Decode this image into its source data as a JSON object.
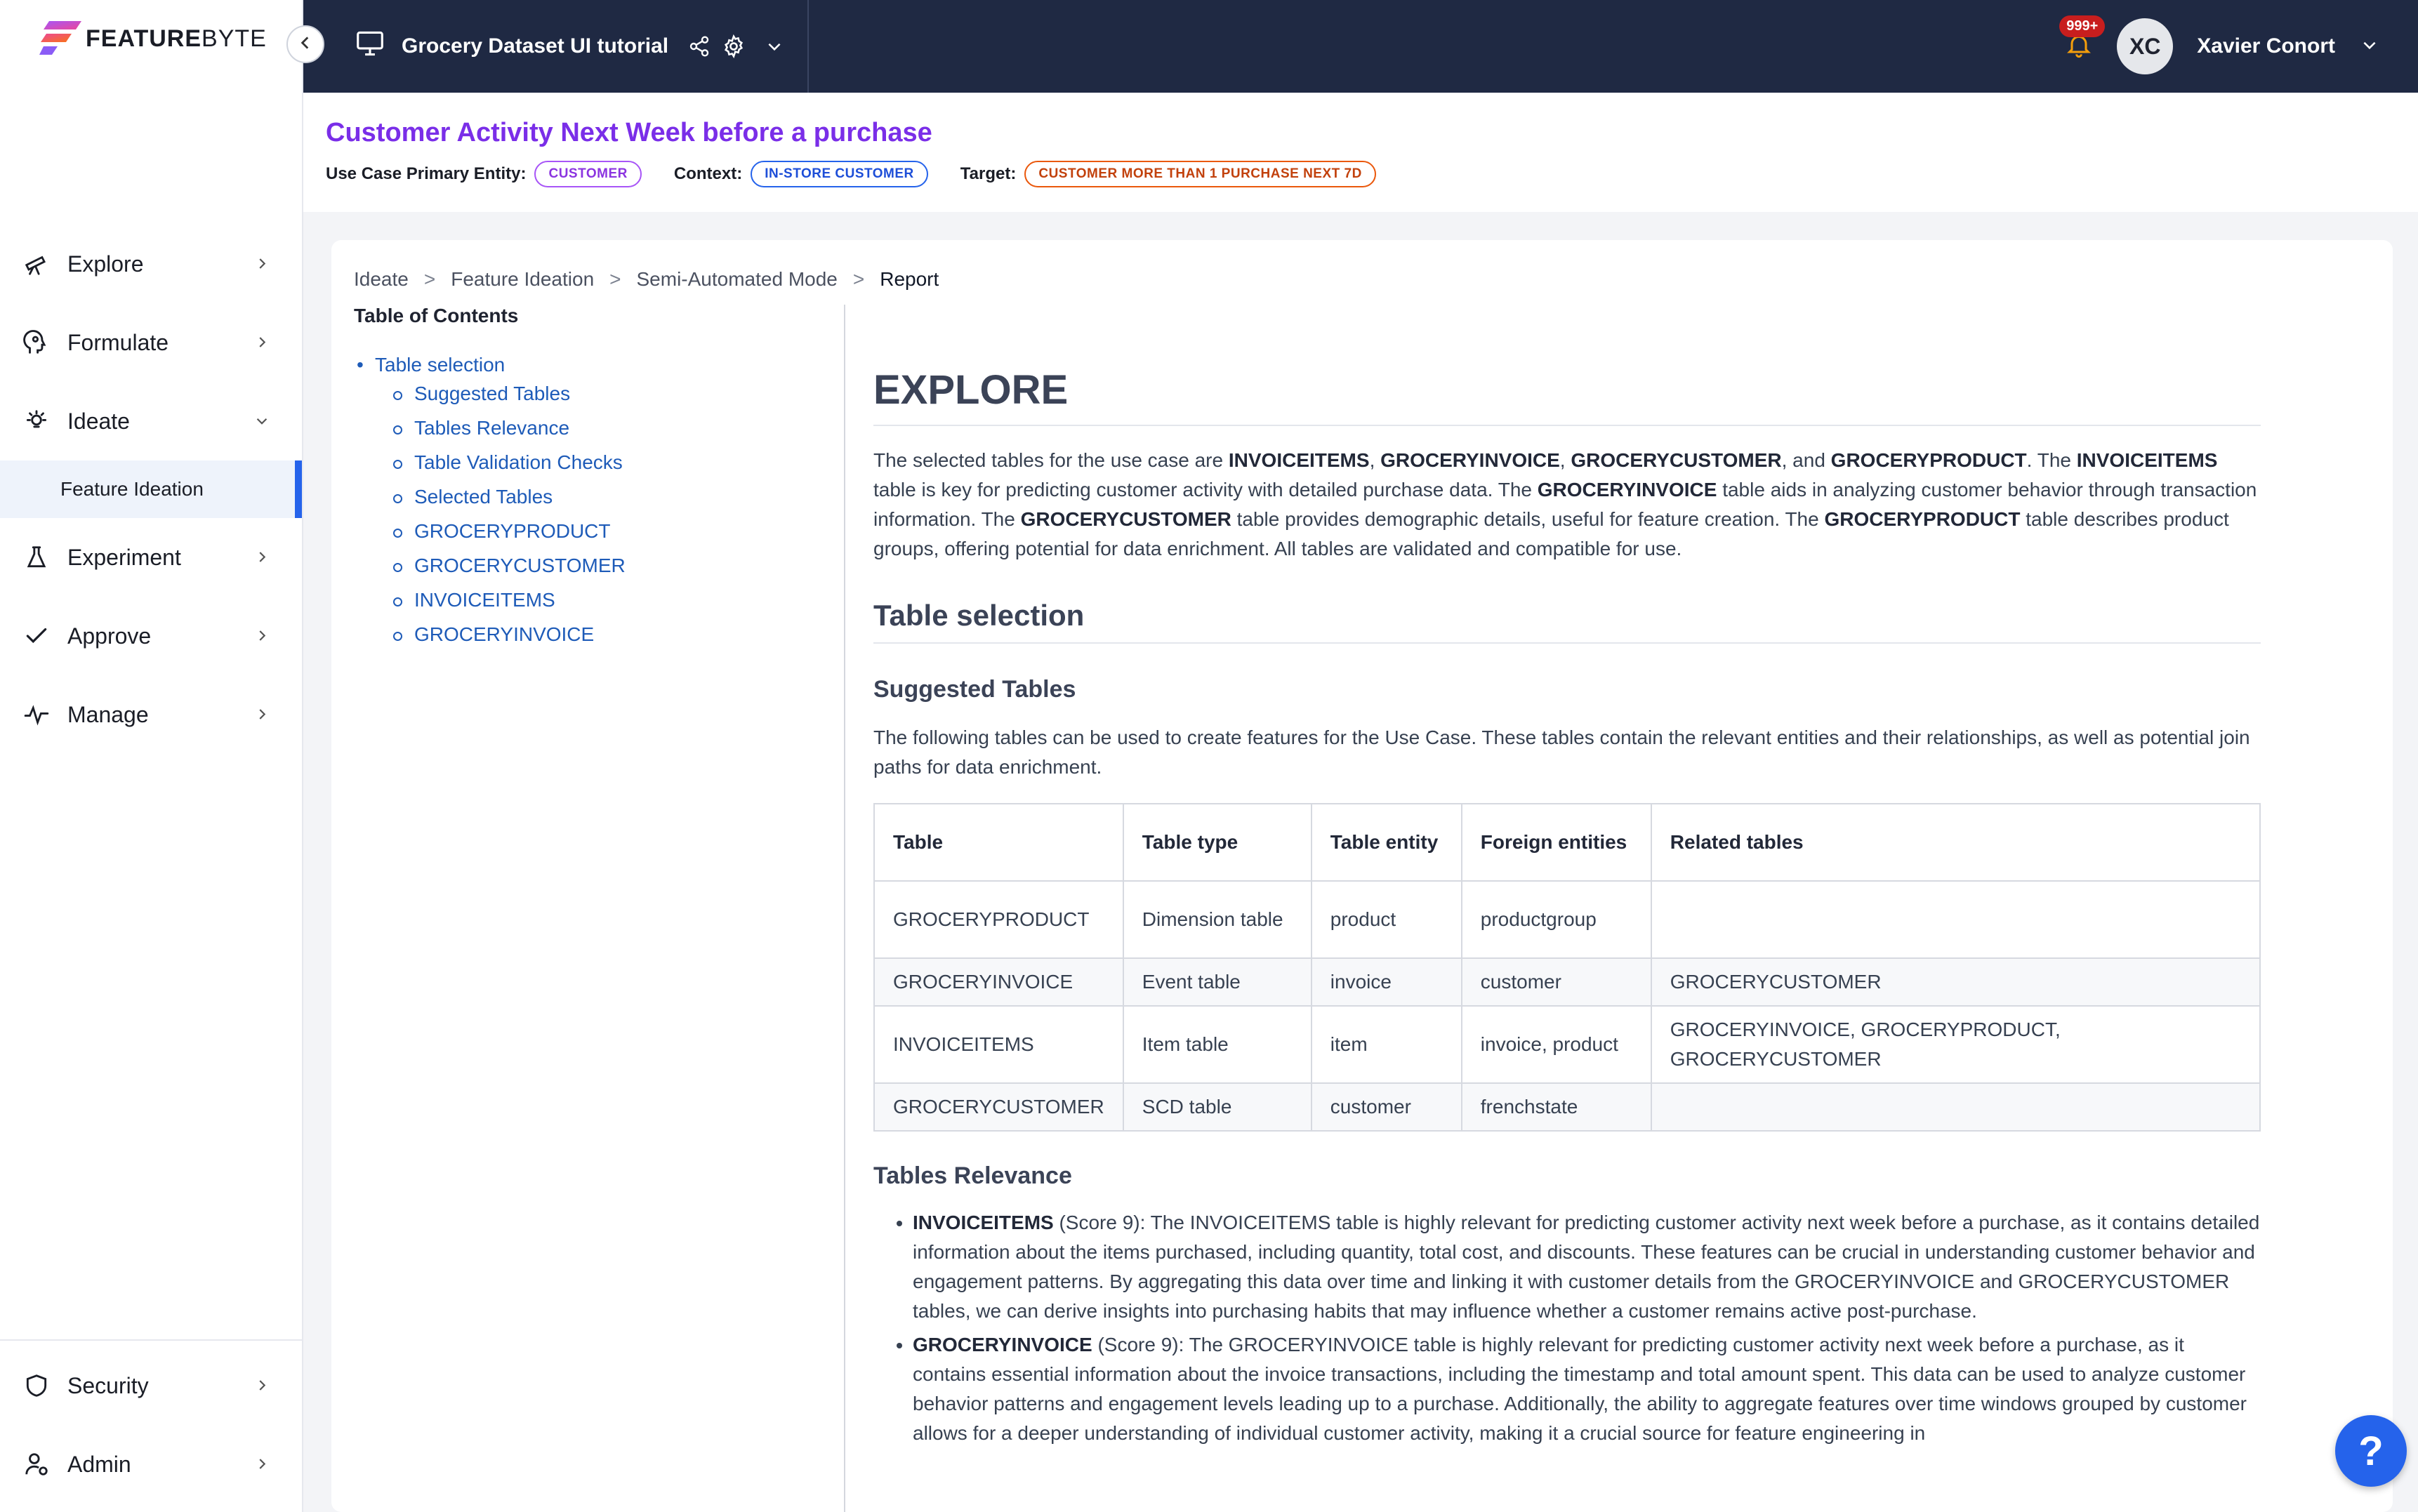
{
  "brand": {
    "name_bold": "FEATURE",
    "name_light": "BYTE"
  },
  "sidebar": {
    "items": [
      {
        "label": "Explore",
        "icon": "telescope-icon"
      },
      {
        "label": "Formulate",
        "icon": "head-icon"
      },
      {
        "label": "Ideate",
        "icon": "lightbulb-icon",
        "expanded": true
      },
      {
        "label": "Experiment",
        "icon": "flask-icon"
      },
      {
        "label": "Approve",
        "icon": "check-icon"
      },
      {
        "label": "Manage",
        "icon": "pulse-icon"
      }
    ],
    "active_sub_item": "Feature Ideation",
    "bottom_items": [
      {
        "label": "Security",
        "icon": "shield-icon"
      },
      {
        "label": "Admin",
        "icon": "user-gear-icon"
      }
    ]
  },
  "topbar": {
    "project_name": "Grocery Dataset UI tutorial",
    "notifications_badge": "999+",
    "user_initials": "XC",
    "user_name": "Xavier Conort"
  },
  "use_case": {
    "title": "Customer Activity Next Week before a purchase",
    "primary_entity_label": "Use Case Primary Entity:",
    "primary_entity": "CUSTOMER",
    "context_label": "Context:",
    "context": "IN-STORE CUSTOMER",
    "target_label": "Target:",
    "target": "CUSTOMER MORE THAN 1 PURCHASE NEXT 7D"
  },
  "breadcrumb": [
    "Ideate",
    "Feature Ideation",
    "Semi-Automated Mode",
    "Report"
  ],
  "breadcrumb_sep": ">",
  "toc": {
    "title": "Table of Contents",
    "top": "Table selection",
    "items": [
      "Suggested Tables",
      "Tables Relevance",
      "Table Validation Checks",
      "Selected Tables",
      "GROCERYPRODUCT",
      "GROCERYCUSTOMER",
      "INVOICEITEMS",
      "GROCERYINVOICE"
    ]
  },
  "report": {
    "h1": "EXPLORE",
    "intro": {
      "t1": "The selected tables for the use case are ",
      "b1": "INVOICEITEMS",
      "t2": ", ",
      "b2": "GROCERYINVOICE",
      "t3": ", ",
      "b3": "GROCERYCUSTOMER",
      "t4": ", and ",
      "b4": "GROCERYPRODUCT",
      "t5": ". The ",
      "b5": "INVOICEITEMS",
      "t6": " table is key for predicting customer activity with detailed purchase data. The ",
      "b6": "GROCERYINVOICE",
      "t7": " table aids in analyzing customer behavior through transaction information. The ",
      "b7": "GROCERYCUSTOMER",
      "t8": " table provides demographic details, useful for feature creation. The ",
      "b8": "GROCERYPRODUCT",
      "t9": " table describes product groups, offering potential for data enrichment. All tables are validated and compatible for use."
    },
    "h2": "Table selection",
    "h3_suggested": "Suggested Tables",
    "suggested_intro": "The following tables can be used to create features for the Use Case. These tables contain the relevant entities and their relationships, as well as potential join paths for data enrichment.",
    "table": {
      "headers": [
        "Table",
        "Table type",
        "Table entity",
        "Foreign entities",
        "Related tables"
      ],
      "rows": [
        [
          "GROCERYPRODUCT",
          "Dimension table",
          "product",
          "productgroup",
          ""
        ],
        [
          "GROCERYINVOICE",
          "Event table",
          "invoice",
          "customer",
          "GROCERYCUSTOMER"
        ],
        [
          "INVOICEITEMS",
          "Item table",
          "item",
          "invoice, product",
          "GROCERYINVOICE, GROCERYPRODUCT, GROCERYCUSTOMER"
        ],
        [
          "GROCERYCUSTOMER",
          "SCD table",
          "customer",
          "frenchstate",
          ""
        ]
      ]
    },
    "h3_relevance": "Tables Relevance",
    "relevance": [
      {
        "name": "INVOICEITEMS",
        "text": " (Score 9): The INVOICEITEMS table is highly relevant for predicting customer activity next week before a purchase, as it contains detailed information about the items purchased, including quantity, total cost, and discounts. These features can be crucial in understanding customer behavior and engagement patterns. By aggregating this data over time and linking it with customer details from the GROCERYINVOICE and GROCERYCUSTOMER tables, we can derive insights into purchasing habits that may influence whether a customer remains active post-purchase."
      },
      {
        "name": "GROCERYINVOICE",
        "text": " (Score 9): The GROCERYINVOICE table is highly relevant for predicting customer activity next week before a purchase, as it contains essential information about the invoice transactions, including the timestamp and total amount spent. This data can be used to analyze customer behavior patterns and engagement levels leading up to a purchase. Additionally, the ability to aggregate features over time windows grouped by customer allows for a deeper understanding of individual customer activity, making it a crucial source for feature engineering in"
      }
    ]
  },
  "help_label": "?"
}
